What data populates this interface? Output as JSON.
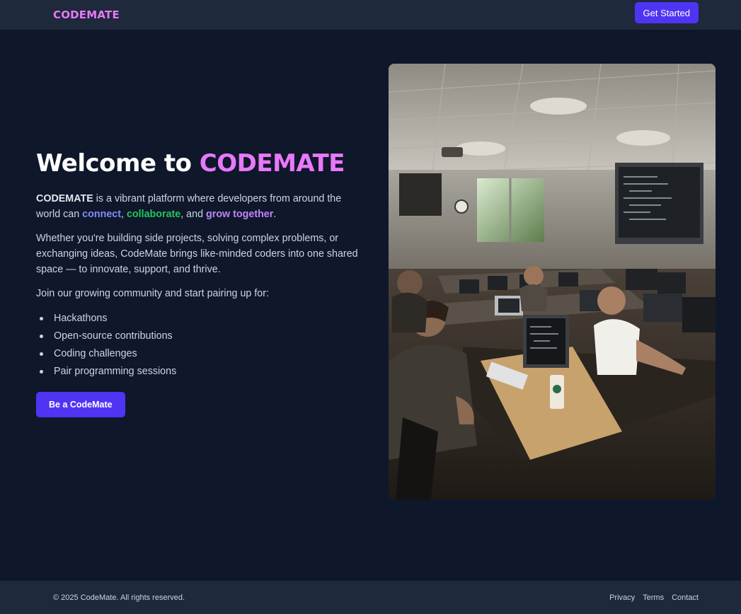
{
  "navbar": {
    "logo": "CODEMATE",
    "cta_label": "Get Started"
  },
  "hero": {
    "title_prefix": "Welcome to ",
    "title_brand": "CODEMATE",
    "intro": {
      "brand": "CODEMATE",
      "text_1": " is a vibrant platform where developers from around the world can ",
      "connect": "connect",
      "sep_1": ", ",
      "collaborate": "collaborate",
      "sep_2": ", and ",
      "grow": "grow together",
      "end": "."
    },
    "paragraph_2": "Whether you're building side projects, solving complex problems, or exchanging ideas, CodeMate brings like-minded coders into one shared space — to innovate, support, and thrive.",
    "paragraph_3": "Join our growing community and start pairing up for:",
    "features": [
      "Hackathons",
      "Open-source contributions",
      "Coding challenges",
      "Pair programming sessions"
    ],
    "cta_label": "Be a CodeMate",
    "image_icon": "classroom-photo"
  },
  "footer": {
    "copyright": "© 2025 CodeMate. All rights reserved.",
    "links": [
      "Privacy",
      "Terms",
      "Contact"
    ]
  },
  "colors": {
    "background": "#0f172a",
    "bar": "#1e293b",
    "accent": "#4f35f3",
    "brand": "#e879f9",
    "connect": "#818cf8",
    "collaborate": "#22c55e",
    "grow": "#c084fc"
  }
}
